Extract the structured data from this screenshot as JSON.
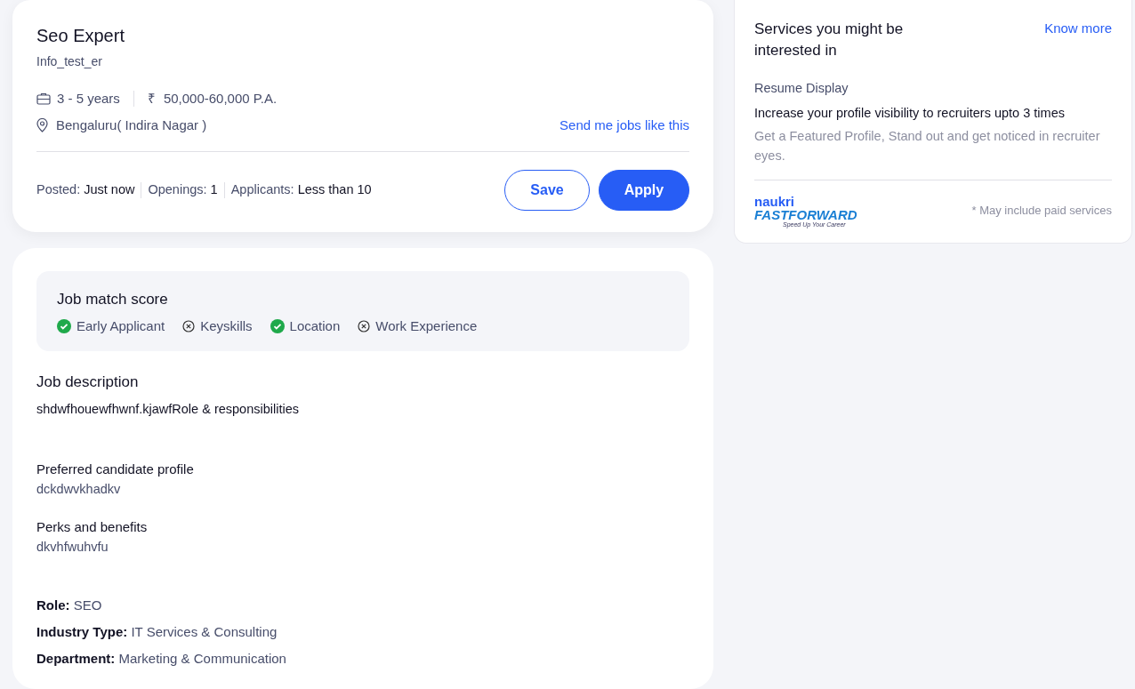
{
  "job": {
    "title": "Seo Expert",
    "company": "Info_test_er",
    "experience": "3 - 5 years",
    "salary": "50,000-60,000 P.A.",
    "currency_symbol": "₹",
    "location": "Bengaluru( Indira Nagar )",
    "send_link": "Send me jobs like this",
    "stats": [
      {
        "label": "Posted:",
        "value": "Just now"
      },
      {
        "label": "Openings:",
        "value": "1"
      },
      {
        "label": "Applicants:",
        "value": "Less than 10"
      }
    ],
    "buttons": [
      {
        "kind": "outline",
        "label": "Save"
      },
      {
        "kind": "filled",
        "label": "Apply"
      }
    ]
  },
  "match": {
    "title": "Job match score",
    "items": [
      {
        "label": "Early Applicant",
        "matched": true
      },
      {
        "label": "Keyskills",
        "matched": false
      },
      {
        "label": "Location",
        "matched": true
      },
      {
        "label": "Work Experience",
        "matched": false
      }
    ]
  },
  "description": {
    "title": "Job description",
    "intro": "shdwfhouewfhwnf.kjawfRole & responsibilities",
    "sections": [
      {
        "heading": "Preferred candidate profile",
        "body": "dckdwvkhadkv"
      },
      {
        "heading": "Perks and benefits",
        "body": "dkvhfwuhvfu"
      }
    ],
    "details": [
      {
        "label": "Role:",
        "value": "SEO"
      },
      {
        "label": "Industry Type:",
        "value": "IT Services & Consulting"
      },
      {
        "label": "Department:",
        "value": "Marketing & Communication"
      }
    ]
  },
  "services": {
    "title": "Services you might be interested in",
    "link": "Know more",
    "category": "Resume Display",
    "headline": "Increase your profile visibility to recruiters upto 3 times",
    "body": "Get a Featured Profile, Stand out and get noticed in recruiter eyes.",
    "logo": {
      "top": "naukri",
      "main": "FASTFORWARD",
      "tagline": "Speed Up Your Career"
    },
    "note": "* May include paid services"
  }
}
